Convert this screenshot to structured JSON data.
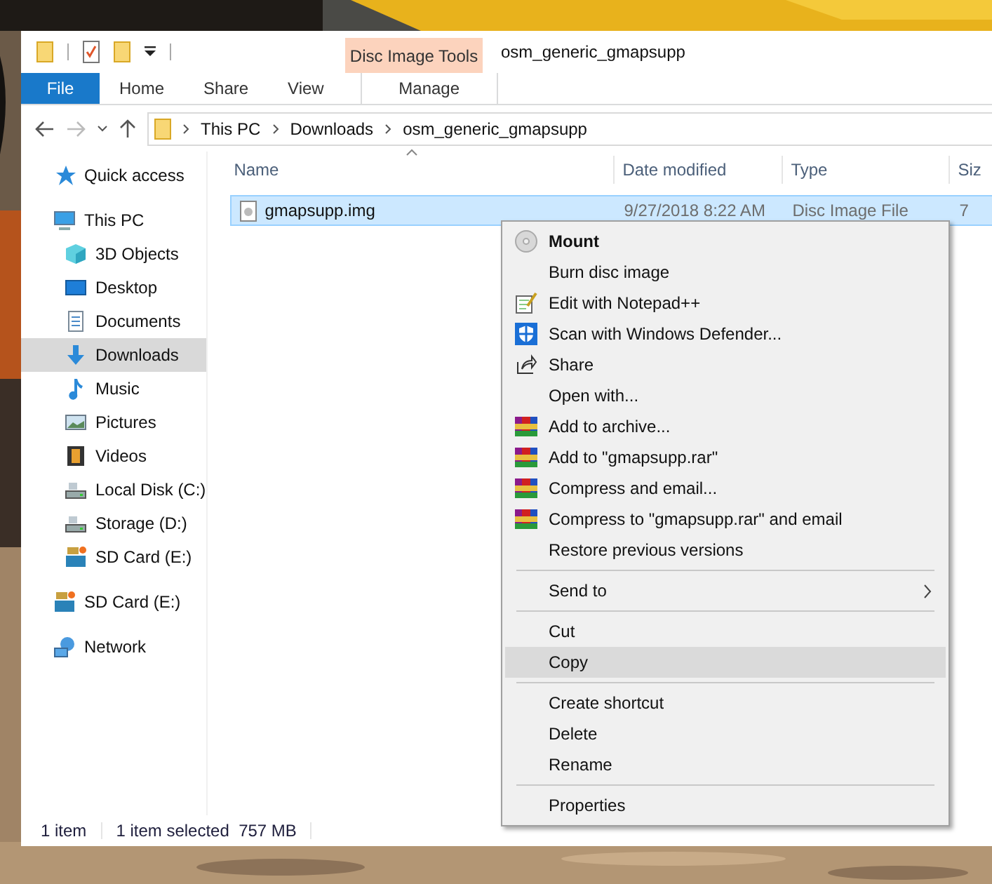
{
  "window": {
    "title": "osm_generic_gmapsupp"
  },
  "quick_access_toolbar": [
    {
      "kind": "folder"
    },
    {
      "kind": "properties"
    },
    {
      "kind": "new-folder"
    },
    {
      "kind": "customize"
    }
  ],
  "context_tab_group": {
    "label": "Disc Image Tools"
  },
  "ribbon_tabs": [
    {
      "label": "File",
      "kind": "file",
      "selected": false
    },
    {
      "label": "Home",
      "kind": "tab",
      "selected": false
    },
    {
      "label": "Share",
      "kind": "tab",
      "selected": false
    },
    {
      "label": "View",
      "kind": "tab",
      "selected": false
    },
    {
      "label": "Manage",
      "kind": "context",
      "selected": false
    }
  ],
  "address_bar": {
    "breadcrumbs": [
      "This PC",
      "Downloads",
      "osm_generic_gmapsupp"
    ]
  },
  "nav_pane": [
    {
      "label": "Quick access",
      "kind": "star",
      "selected": false
    },
    {
      "label": "This PC",
      "kind": "pc",
      "selected": false,
      "children": [
        {
          "label": "3D Objects",
          "kind": "cube",
          "selected": false
        },
        {
          "label": "Desktop",
          "kind": "desktop",
          "selected": false
        },
        {
          "label": "Documents",
          "kind": "document",
          "selected": false
        },
        {
          "label": "Downloads",
          "kind": "download",
          "selected": true
        },
        {
          "label": "Music",
          "kind": "music",
          "selected": false
        },
        {
          "label": "Pictures",
          "kind": "pictures",
          "selected": false
        },
        {
          "label": "Videos",
          "kind": "videos",
          "selected": false
        },
        {
          "label": "Local Disk (C:)",
          "kind": "drive",
          "selected": false
        },
        {
          "label": "Storage (D:)",
          "kind": "drive",
          "selected": false
        },
        {
          "label": "SD Card (E:)",
          "kind": "sd",
          "selected": false
        }
      ]
    },
    {
      "label": "SD Card (E:)",
      "kind": "sd",
      "selected": false
    },
    {
      "label": "Network",
      "kind": "network",
      "selected": false
    }
  ],
  "file_list": {
    "columns": [
      {
        "label": "Name",
        "sorted": true
      },
      {
        "label": "Date modified",
        "sorted": false
      },
      {
        "label": "Type",
        "sorted": false
      },
      {
        "label": "Siz",
        "sorted": false
      }
    ],
    "rows": [
      {
        "cells": [
          "gmapsupp.img",
          "9/27/2018 8:22 AM",
          "Disc Image File",
          "7"
        ],
        "selected": true
      }
    ]
  },
  "status_bar": [
    "1 item",
    "1 item selected  757 MB"
  ],
  "context_menu": {
    "groups": [
      [
        {
          "label": "Mount",
          "kind": "disc",
          "default": true,
          "submenu": false,
          "selected": false
        },
        {
          "label": "Burn disc image",
          "kind": "plain",
          "default": false,
          "submenu": false,
          "selected": false
        },
        {
          "label": "Edit with Notepad++",
          "kind": "notepad",
          "default": false,
          "submenu": false,
          "selected": false
        },
        {
          "label": "Scan with Windows Defender...",
          "kind": "shield",
          "default": false,
          "submenu": false,
          "selected": false
        },
        {
          "label": "Share",
          "kind": "share",
          "default": false,
          "submenu": false,
          "selected": false
        },
        {
          "label": "Open with...",
          "kind": "plain",
          "default": false,
          "submenu": false,
          "selected": false
        },
        {
          "label": "Add to archive...",
          "kind": "archive",
          "default": false,
          "submenu": false,
          "selected": false
        },
        {
          "label": "Add to \"gmapsupp.rar\"",
          "kind": "archive",
          "default": false,
          "submenu": false,
          "selected": false
        },
        {
          "label": "Compress and email...",
          "kind": "archive",
          "default": false,
          "submenu": false,
          "selected": false
        },
        {
          "label": "Compress to \"gmapsupp.rar\" and email",
          "kind": "archive",
          "default": false,
          "submenu": false,
          "selected": false
        },
        {
          "label": "Restore previous versions",
          "kind": "plain",
          "default": false,
          "submenu": false,
          "selected": false
        }
      ],
      [
        {
          "label": "Send to",
          "kind": "plain",
          "default": false,
          "submenu": true,
          "selected": false
        }
      ],
      [
        {
          "label": "Cut",
          "kind": "plain",
          "default": false,
          "submenu": false,
          "selected": false
        },
        {
          "label": "Copy",
          "kind": "plain",
          "default": false,
          "submenu": false,
          "selected": true
        }
      ],
      [
        {
          "label": "Create shortcut",
          "kind": "plain",
          "default": false,
          "submenu": false,
          "selected": false
        },
        {
          "label": "Delete",
          "kind": "plain",
          "default": false,
          "submenu": false,
          "selected": false
        },
        {
          "label": "Rename",
          "kind": "plain",
          "default": false,
          "submenu": false,
          "selected": false
        }
      ],
      [
        {
          "label": "Properties",
          "kind": "plain",
          "default": false,
          "submenu": false,
          "selected": false
        }
      ]
    ]
  }
}
